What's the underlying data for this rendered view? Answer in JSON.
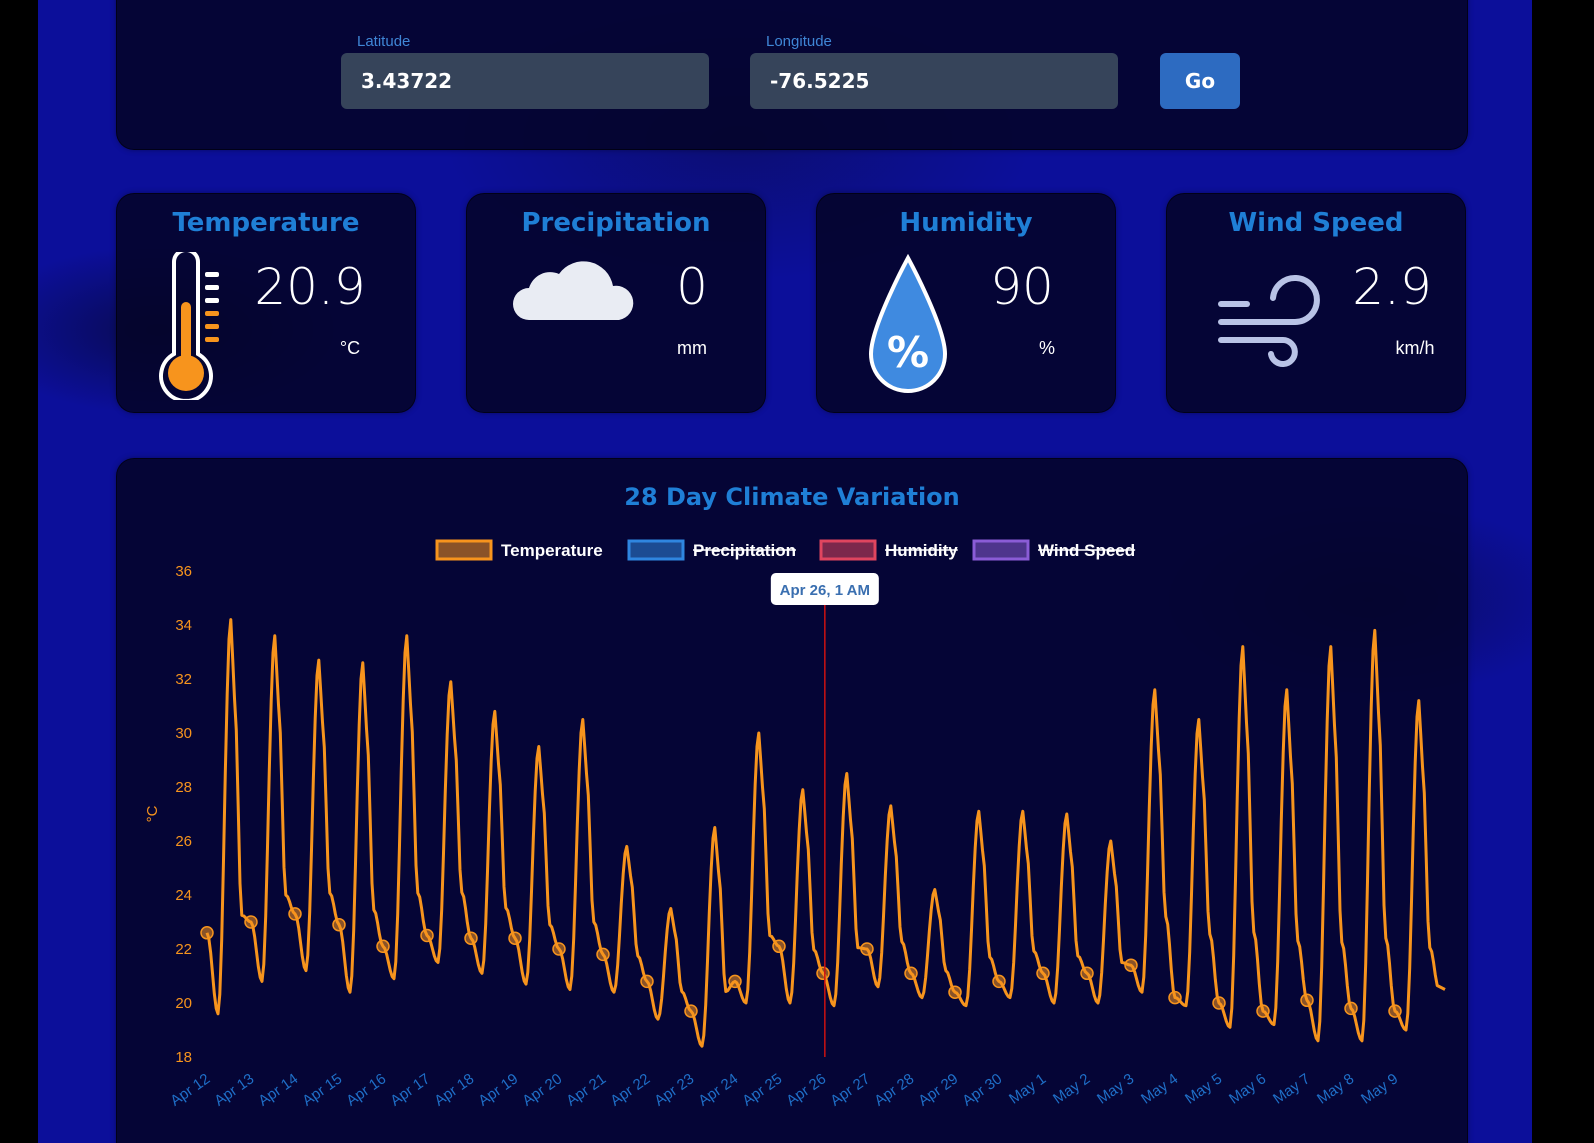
{
  "coords": {
    "latitude_label": "Latitude",
    "latitude_value": "3.43722",
    "longitude_label": "Longitude",
    "longitude_value": "-76.5225",
    "go_label": "Go"
  },
  "cards": [
    {
      "title": "Temperature",
      "value": "20.9",
      "unit": "°C",
      "icon": "thermometer-icon"
    },
    {
      "title": "Precipitation",
      "value": "0",
      "unit": "mm",
      "icon": "cloud-icon"
    },
    {
      "title": "Humidity",
      "value": "90",
      "unit": "%",
      "icon": "humidity-drop-icon"
    },
    {
      "title": "Wind Speed",
      "value": "2.9",
      "unit": "km/h",
      "icon": "wind-icon"
    }
  ],
  "colors": {
    "accent": "#1f7fd6",
    "temperature": "#f7941d",
    "precipitation": "#2f86e0",
    "humidity": "#e0455f",
    "wind": "#8a5cd6",
    "crosshair": "#cc1111"
  },
  "chart_data": {
    "type": "line",
    "title": "28 Day Climate Variation",
    "ylabel": "°C",
    "ylim": [
      18,
      36
    ],
    "yticks": [
      18,
      20,
      22,
      24,
      26,
      28,
      30,
      32,
      34,
      36
    ],
    "legend_position": "top",
    "grid": false,
    "legend": [
      {
        "name": "Temperature",
        "color": "#f7941d",
        "hidden": false
      },
      {
        "name": "Precipitation",
        "color": "#2f86e0",
        "hidden": true
      },
      {
        "name": "Humidity",
        "color": "#e0455f",
        "hidden": true
      },
      {
        "name": "Wind Speed",
        "color": "#8a5cd6",
        "hidden": true
      }
    ],
    "x": [
      "Apr 12",
      "Apr 13",
      "Apr 14",
      "Apr 15",
      "Apr 16",
      "Apr 17",
      "Apr 18",
      "Apr 19",
      "Apr 20",
      "Apr 21",
      "Apr 22",
      "Apr 23",
      "Apr 24",
      "Apr 25",
      "Apr 26",
      "Apr 27",
      "Apr 28",
      "Apr 29",
      "Apr 30",
      "May 1",
      "May 2",
      "May 3",
      "May 4",
      "May 5",
      "May 6",
      "May 7",
      "May 8",
      "May 9"
    ],
    "series": [
      {
        "name": "Temperature",
        "daily_max": [
          34.2,
          33.6,
          32.7,
          32.6,
          33.6,
          31.9,
          30.8,
          29.5,
          30.5,
          25.8,
          23.5,
          26.5,
          30.0,
          27.9,
          28.5,
          27.3,
          24.2,
          27.1,
          27.1,
          27.0,
          26.0,
          31.6,
          30.5,
          33.2,
          31.6,
          33.2,
          33.8,
          31.2
        ],
        "daily_min": [
          19.6,
          20.8,
          21.2,
          20.4,
          20.9,
          21.5,
          21.1,
          20.7,
          20.5,
          20.4,
          19.4,
          18.4,
          20.0,
          20.0,
          19.9,
          20.6,
          20.2,
          19.9,
          20.2,
          20.0,
          20.0,
          20.4,
          19.9,
          19.1,
          19.2,
          18.6,
          18.6,
          19.0
        ],
        "midnight_values": [
          22.6,
          23.0,
          23.3,
          22.9,
          22.1,
          22.5,
          22.4,
          22.4,
          22.0,
          21.8,
          20.8,
          19.7,
          20.8,
          22.1,
          21.1,
          22.0,
          21.1,
          20.4,
          20.8,
          21.1,
          21.1,
          21.4,
          20.2,
          20.0,
          19.7,
          20.1,
          19.8,
          19.7
        ],
        "end_value": 20.5
      }
    ],
    "tooltip": "Apr 26, 1 AM"
  }
}
